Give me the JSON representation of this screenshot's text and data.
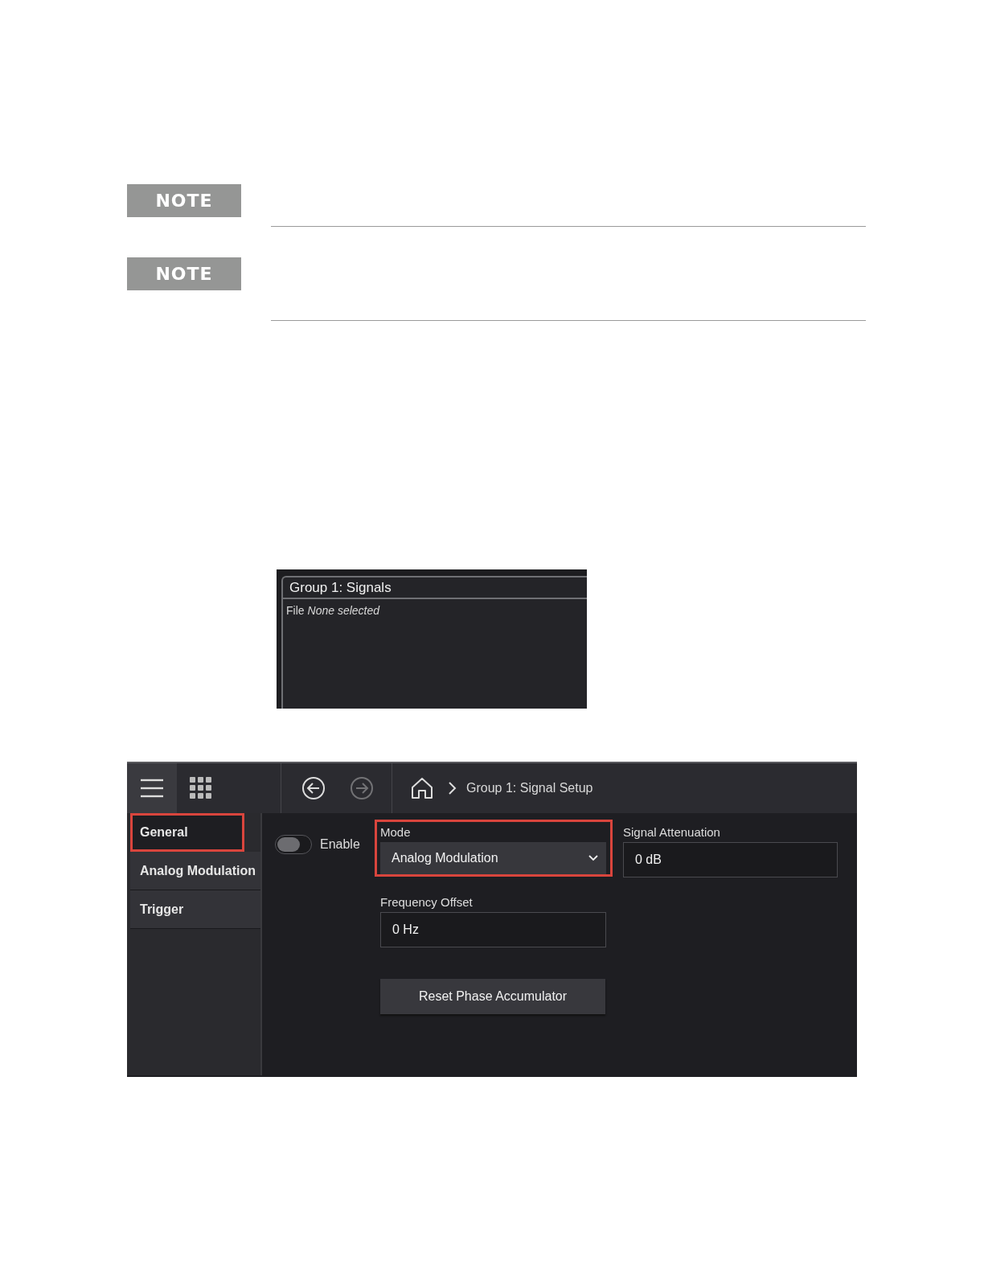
{
  "notes": [
    {
      "label": "NOTE"
    },
    {
      "label": "NOTE"
    }
  ],
  "signals_panel": {
    "title": "Group 1: Signals",
    "file_label": "File",
    "file_value": "None selected"
  },
  "setup_window": {
    "breadcrumb": "Group 1: Signal Setup",
    "nav": {
      "back_enabled": true,
      "forward_enabled": false
    },
    "sidebar": {
      "items": [
        {
          "label": "General",
          "selected": true,
          "highlighted": true
        },
        {
          "label": "Analog Modulation",
          "selected": false,
          "highlighted": false
        },
        {
          "label": "Trigger",
          "selected": false,
          "highlighted": false
        }
      ]
    },
    "enable": {
      "label": "Enable",
      "on": false
    },
    "fields": [
      {
        "kind": "select",
        "label": "Mode",
        "value": "Analog Modulation",
        "highlighted": true
      },
      {
        "kind": "input",
        "label": "Signal Attenuation",
        "value": "0 dB",
        "highlighted": false
      },
      {
        "kind": "input",
        "label": "Frequency Offset",
        "value": "0 Hz",
        "highlighted": false
      }
    ],
    "button": "Reset Phase Accumulator"
  }
}
